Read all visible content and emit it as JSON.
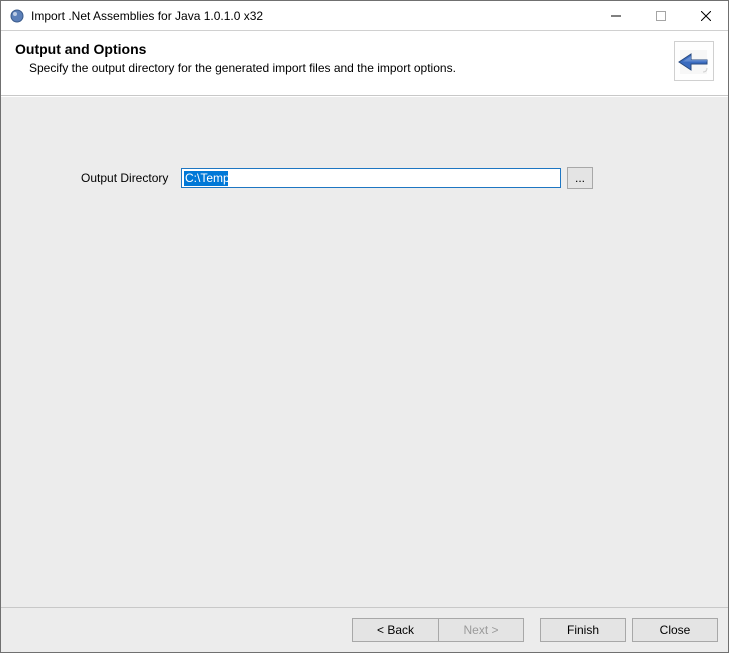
{
  "window": {
    "title": "Import .Net Assemblies for Java 1.0.1.0 x32"
  },
  "header": {
    "title": "Output and Options",
    "subtitle": "Specify the output directory for the generated import files and the import options."
  },
  "form": {
    "output_dir_label": "Output Directory",
    "output_dir_value": "C:\\Temp",
    "browse_label": "..."
  },
  "footer": {
    "back": "< Back",
    "next": "Next >",
    "finish": "Finish",
    "close": "Close"
  }
}
